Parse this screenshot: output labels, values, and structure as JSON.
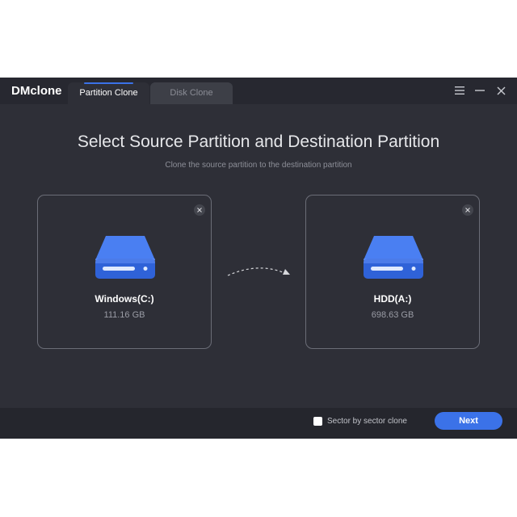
{
  "app": {
    "title": "DMclone",
    "tabs": [
      {
        "label": "Partition Clone",
        "active": true
      },
      {
        "label": "Disk Clone",
        "active": false
      }
    ],
    "window_controls": [
      "menu-icon",
      "minimize-icon",
      "close-icon"
    ]
  },
  "main": {
    "heading": "Select Source Partition and Destination Partition",
    "subheading": "Clone the source partition to the destination partition",
    "source": {
      "name": "Windows(C:)",
      "size": "111.16 GB",
      "icon": "drive-icon"
    },
    "destination": {
      "name": "HDD(A:)",
      "size": "698.63 GB",
      "icon": "drive-icon"
    }
  },
  "footer": {
    "sector_clone_label": "Sector by sector clone",
    "sector_clone_checked": false,
    "next_label": "Next"
  },
  "colors": {
    "accent": "#3b72e8",
    "window_bg": "#2e2f37",
    "titlebar_bg": "#272830",
    "drive_blue": "#3f74ee"
  }
}
